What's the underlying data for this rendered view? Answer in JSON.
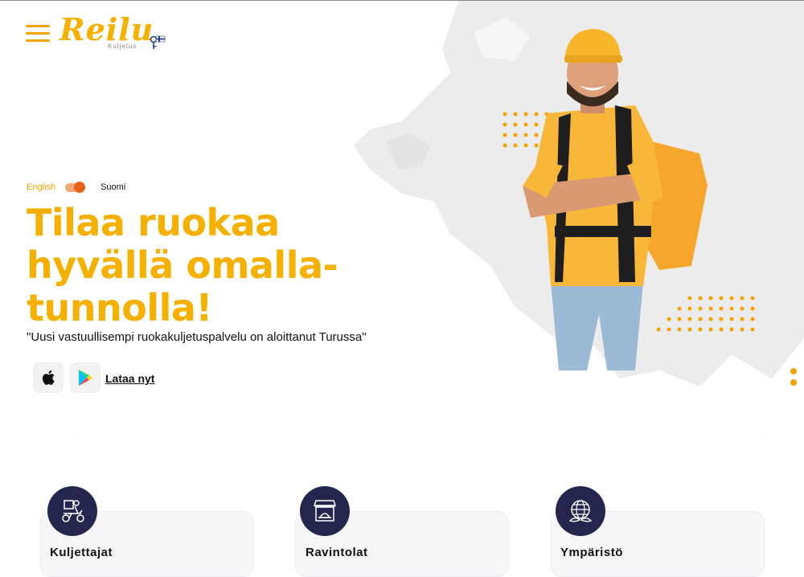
{
  "brand": {
    "logo_word": "Reilu",
    "logo_sub": "Kuljetus"
  },
  "language": {
    "left": "English",
    "right": "Suomi"
  },
  "hero": {
    "headline": "Tilaa ruokaa hyvällä omalla-tunnolla!",
    "tagline": "\"Uusi vastuullisempi ruokakuljetuspalvelu on aloittanut Turussa\"",
    "download_label": "Lataa nyt"
  },
  "cards": [
    {
      "title": "Kuljettajat",
      "icon": "scooter-courier-icon"
    },
    {
      "title": "Ravintolat",
      "icon": "restaurant-icon"
    },
    {
      "title": "Ympäristö",
      "icon": "globe-leaf-icon"
    }
  ],
  "colors": {
    "accent": "#f5b000",
    "toggle": "#e8611c",
    "icon_bg": "#25264d"
  }
}
